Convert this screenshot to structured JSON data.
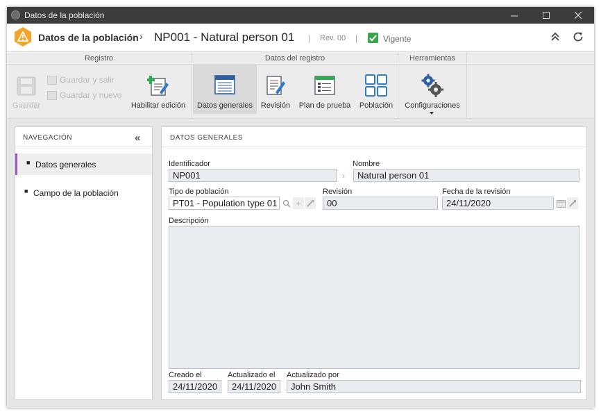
{
  "window": {
    "title": "Datos de la población"
  },
  "header": {
    "title": "Datos de la población",
    "breadcrumb_sep": "›",
    "record": "NP001 - Natural person 01",
    "revision": "Rev. 00",
    "divider": "|",
    "status": "Vigente",
    "status_color": "#3aa64a",
    "warning_color": "#f3a52b"
  },
  "ribbon": {
    "groups": [
      {
        "title": "Registro"
      },
      {
        "title": "Datos del registro"
      },
      {
        "title": "Herramientas"
      }
    ],
    "save": "Guardar",
    "save_exit": "Guardar y salir",
    "save_new": "Guardar y nuevo",
    "enable_edit": "Habilitar edición",
    "general_data": "Datos generales",
    "revision": "Revisión",
    "test_plan": "Plan de prueba",
    "population": "Población",
    "settings": "Configuraciones"
  },
  "nav": {
    "title": "NAVEGACIÓN",
    "items": [
      {
        "label": "Datos generales",
        "selected": true
      },
      {
        "label": "Campo de la población",
        "selected": false
      }
    ],
    "accent_color": "#9a5bc4"
  },
  "form": {
    "title": "DATOS GENERALES",
    "identifier_label": "Identificador",
    "identifier_value": "NP001",
    "name_label": "Nombre",
    "name_value": "Natural person 01",
    "type_label": "Tipo de población",
    "type_value": "PT01 - Population type 01",
    "revision_label": "Revisión",
    "revision_value": "00",
    "rev_date_label": "Fecha de la revisión",
    "rev_date_value": "24/11/2020",
    "description_label": "Descripción",
    "description_value": "",
    "created_label": "Creado el",
    "created_value": "24/11/2020",
    "updated_label": "Actualizado el",
    "updated_value": "24/11/2020",
    "updated_by_label": "Actualizado por",
    "updated_by_value": "John Smith"
  }
}
